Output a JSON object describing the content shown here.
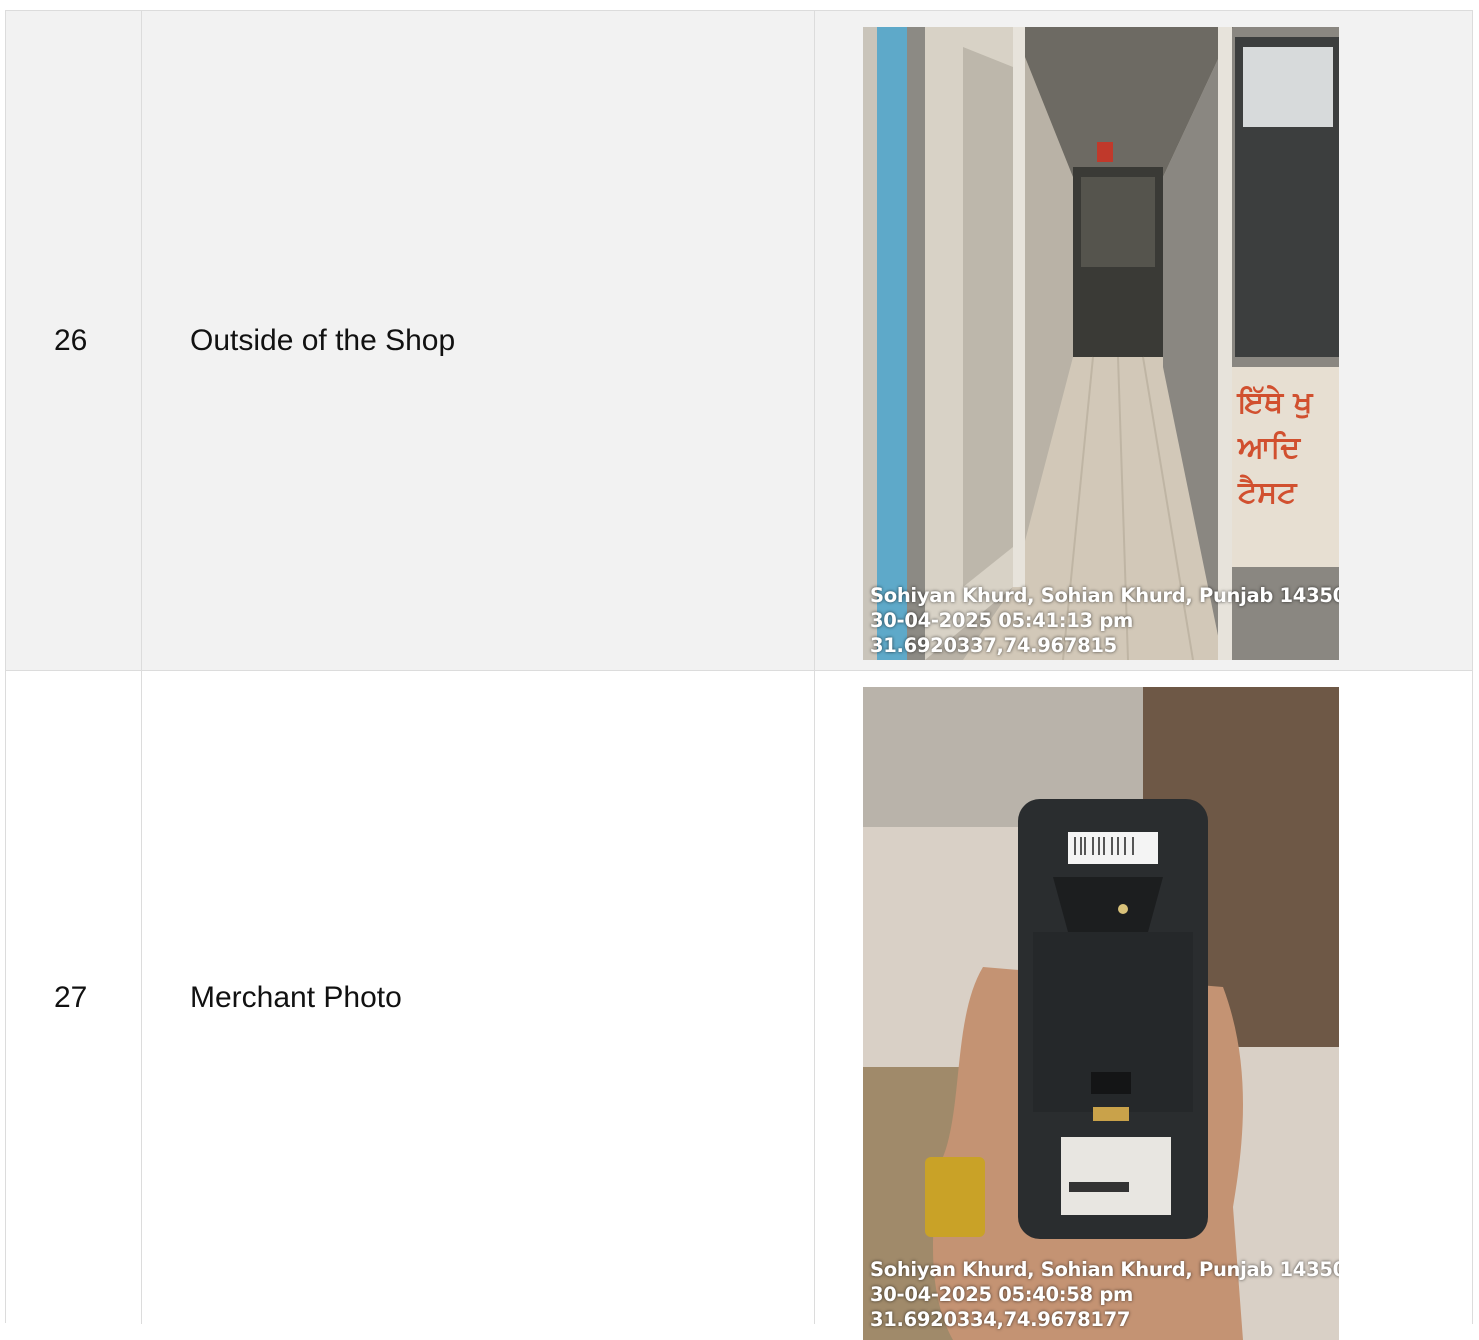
{
  "rows": [
    {
      "number": "26",
      "label": "Outside of the Shop",
      "photo": {
        "description_icon": "shop-entrance-photo",
        "stamp": {
          "address": "Sohiyan Khurd, Sohian Khurd, Punjab 14350",
          "datetime": "30-04-2025 05:41:13 pm",
          "coords": "31.6920337,74.967815"
        }
      }
    },
    {
      "number": "27",
      "label": "Merchant Photo",
      "photo": {
        "description_icon": "pos-terminal-photo",
        "stamp": {
          "address": "Sohiyan Khurd, Sohian Khurd, Punjab 14350",
          "datetime": "30-04-2025 05:40:58 pm",
          "coords": "31.6920334,74.9678177"
        }
      }
    }
  ]
}
